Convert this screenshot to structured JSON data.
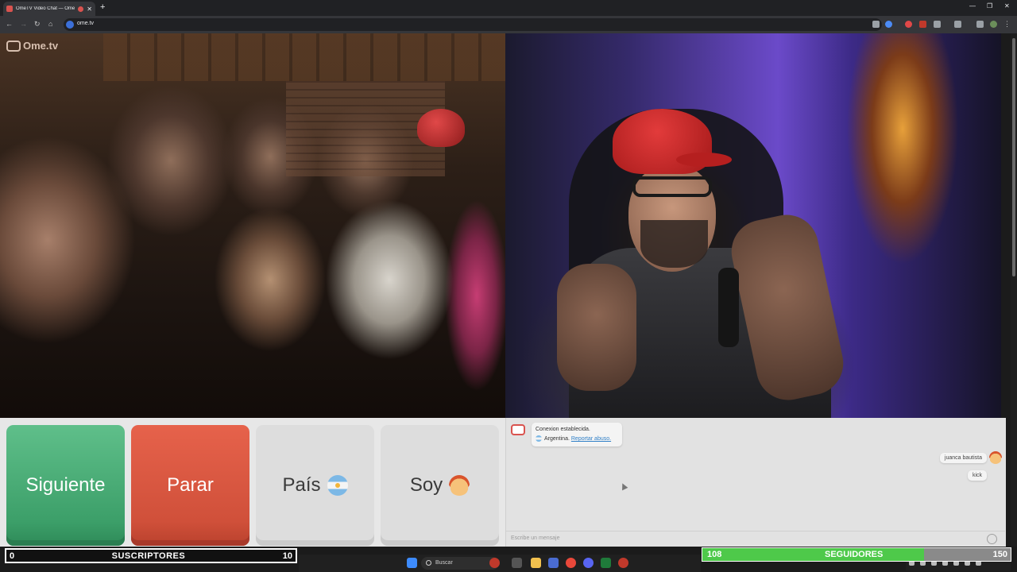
{
  "browser": {
    "tab_title": "OmeTV Video Chat — Ome",
    "url": "ome.tv",
    "new_tab_icon": "plus-icon"
  },
  "app": {
    "logo_text": "Ome.tv"
  },
  "controls": {
    "next_label": "Siguiente",
    "stop_label": "Parar",
    "country_label": "País",
    "gender_label": "Soy"
  },
  "chat": {
    "system_line1": "Conexion establecida.",
    "system_country": "Argentina.",
    "system_report": "Reportar abuso.",
    "messages": [
      {
        "text": "juanca bautista"
      },
      {
        "text": "kick"
      }
    ],
    "input_placeholder": "Escribe un mensaje"
  },
  "overlay": {
    "subs_current": "0",
    "subs_label": "SUSCRIPTORES",
    "subs_goal": "10",
    "followers_current": "108",
    "followers_label": "SEGUIDORES",
    "followers_goal": "150",
    "followers_progress": 0.72
  },
  "taskbar": {
    "search_placeholder": "Buscar"
  },
  "colors": {
    "next": "#3c9f69",
    "stop": "#d0503a",
    "followers_fill": "#4ec94a"
  }
}
